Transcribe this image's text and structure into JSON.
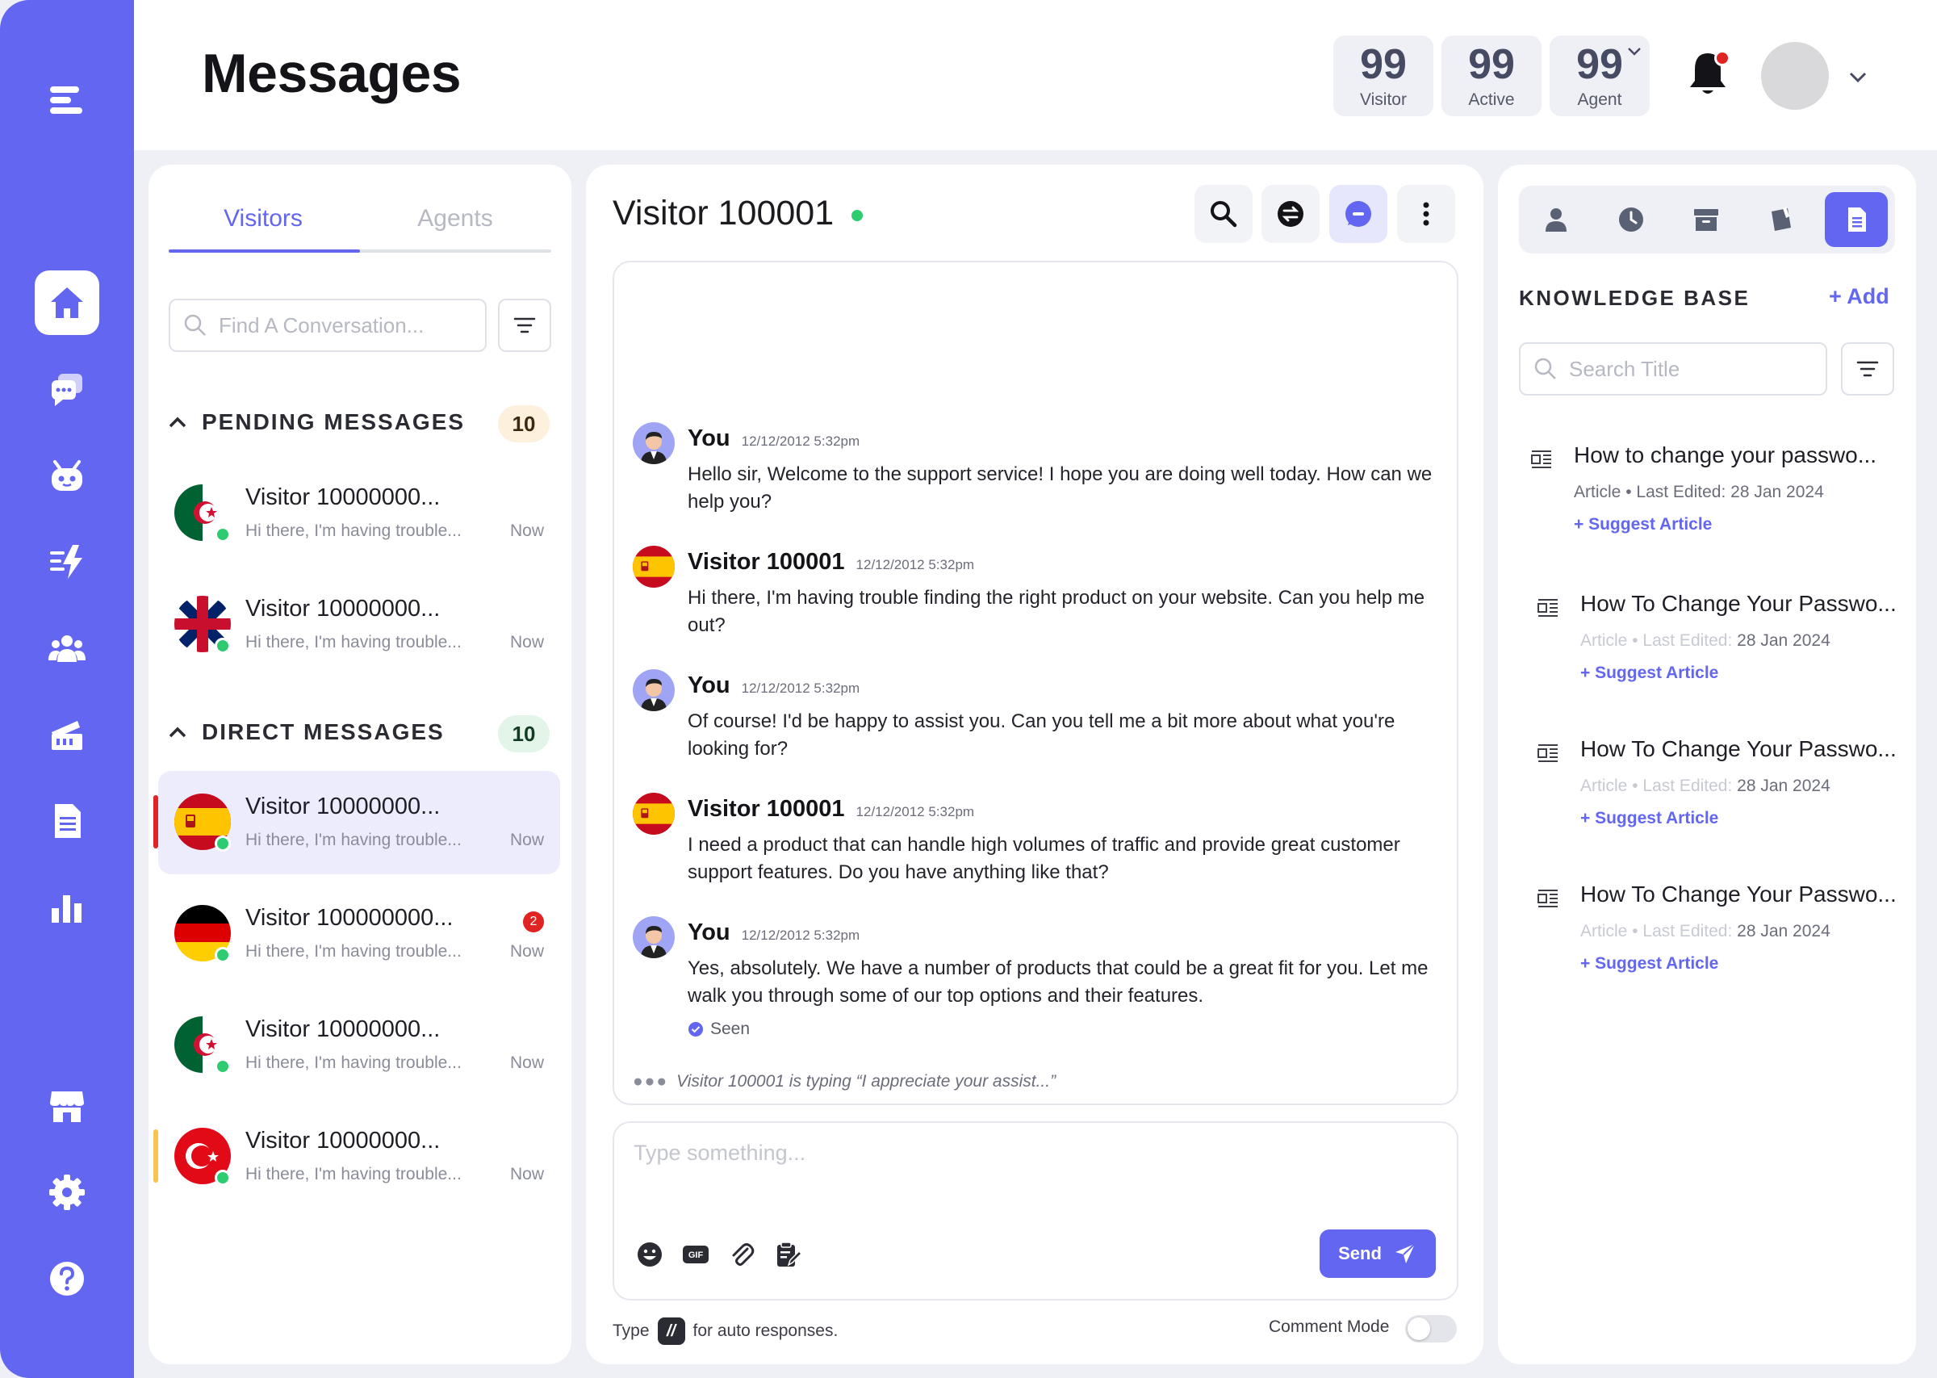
{
  "header": {
    "title": "Messages",
    "stats": [
      {
        "value": "99",
        "label": "Visitor"
      },
      {
        "value": "99",
        "label": "Active"
      },
      {
        "value": "99",
        "label": "Agent"
      }
    ]
  },
  "sidebar": {
    "items": [
      "menu",
      "home",
      "chats",
      "bot",
      "automation",
      "team",
      "tickets",
      "documents",
      "reports",
      "store",
      "settings",
      "help"
    ],
    "accent": "#6366f1"
  },
  "convo_panel": {
    "tabs": [
      "Visitors",
      "Agents"
    ],
    "search_placeholder": "Find A Conversation...",
    "pending": {
      "title": "PENDING MESSAGES",
      "count": "10",
      "items": [
        {
          "name": "Visitor 10000000...",
          "preview": "Hi there, I'm having trouble...",
          "time": "Now",
          "flag": "algeria"
        },
        {
          "name": "Visitor 10000000...",
          "preview": "Hi there, I'm having trouble...",
          "time": "Now",
          "flag": "uk"
        }
      ]
    },
    "direct": {
      "title": "DIRECT MESSAGES",
      "count": "10",
      "items": [
        {
          "name": "Visitor 10000000...",
          "preview": "Hi there, I'm having trouble...",
          "time": "Now",
          "flag": "spain"
        },
        {
          "name": "Visitor 100000000...",
          "preview": "Hi there, I'm having trouble...",
          "time": "Now",
          "flag": "germany",
          "unread": "2"
        },
        {
          "name": "Visitor 10000000...",
          "preview": "Hi there, I'm having trouble...",
          "time": "Now",
          "flag": "algeria"
        },
        {
          "name": "Visitor 10000000...",
          "preview": "Hi there, I'm having trouble...",
          "time": "Now",
          "flag": "turkey"
        }
      ]
    }
  },
  "chat": {
    "title": "Visitor 100001",
    "messages": [
      {
        "sender": "You",
        "time": "12/12/2012 5:32pm",
        "text": "Hello sir, Welcome to the support service! I hope you are doing well today. How can we help you?"
      },
      {
        "sender": "Visitor 100001",
        "time": "12/12/2012 5:32pm",
        "text": "Hi there, I'm having trouble finding the right product on your website. Can you help me out?"
      },
      {
        "sender": "You",
        "time": "12/12/2012 5:32pm",
        "text": "Of course! I'd be happy to assist you. Can you tell me a bit more about what you're looking for?"
      },
      {
        "sender": "Visitor 100001",
        "time": "12/12/2012 5:32pm",
        "text": "I need a product that can handle high volumes of traffic and provide great customer support features. Do you have anything like that?"
      },
      {
        "sender": "You",
        "time": "12/12/2012 5:32pm",
        "text": "Yes, absolutely. We have a number of products that could be a great fit for you. Let me walk you through some of our top options and their features."
      }
    ],
    "seen": "Seen",
    "typing": "Visitor 100001 is typing “I appreciate your assist...”",
    "input_placeholder": "Type something...",
    "send": "Send",
    "footer_type": "Type",
    "footer_key": "//",
    "footer_rest": "for auto responses.",
    "comment_mode": "Comment Mode"
  },
  "kb": {
    "title": "KNOWLEDGE BASE",
    "add": "+ Add",
    "search_placeholder": "Search Title",
    "articles": [
      {
        "title": "How to change your passwo...",
        "type": "Article",
        "label": "Last Edited:",
        "date": "28 Jan 2024",
        "suggest": "+ Suggest Article"
      },
      {
        "title": "How To Change Your Passwo...",
        "type": "Article",
        "label": "Last Edited:",
        "date": "28 Jan 2024",
        "suggest": "+ Suggest Article"
      },
      {
        "title": "How To Change Your Passwo...",
        "type": "Article",
        "label": "Last Edited:",
        "date": "28 Jan 2024",
        "suggest": "+ Suggest Article"
      },
      {
        "title": "How To Change Your Passwo...",
        "type": "Article",
        "label": "Last Edited:",
        "date": "28 Jan 2024",
        "suggest": "+ Suggest Article"
      }
    ]
  }
}
